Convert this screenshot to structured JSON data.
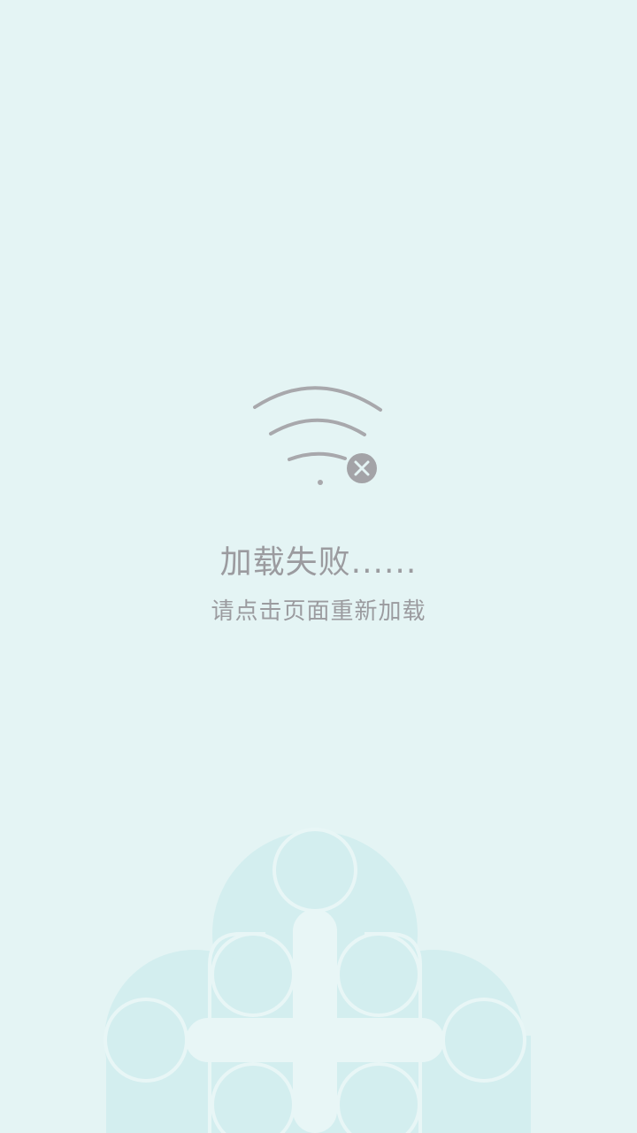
{
  "error": {
    "title": "加载失败......",
    "subtitle": "请点击页面重新加载"
  },
  "icons": {
    "status": "wifi-disconnected-icon",
    "badge": "close-icon",
    "watermark": "logo-watermark"
  },
  "colors": {
    "background": "#e4f4f4",
    "text": "#9b9b9f",
    "icon": "#a3a3a7",
    "watermark": "#d3eeef"
  }
}
